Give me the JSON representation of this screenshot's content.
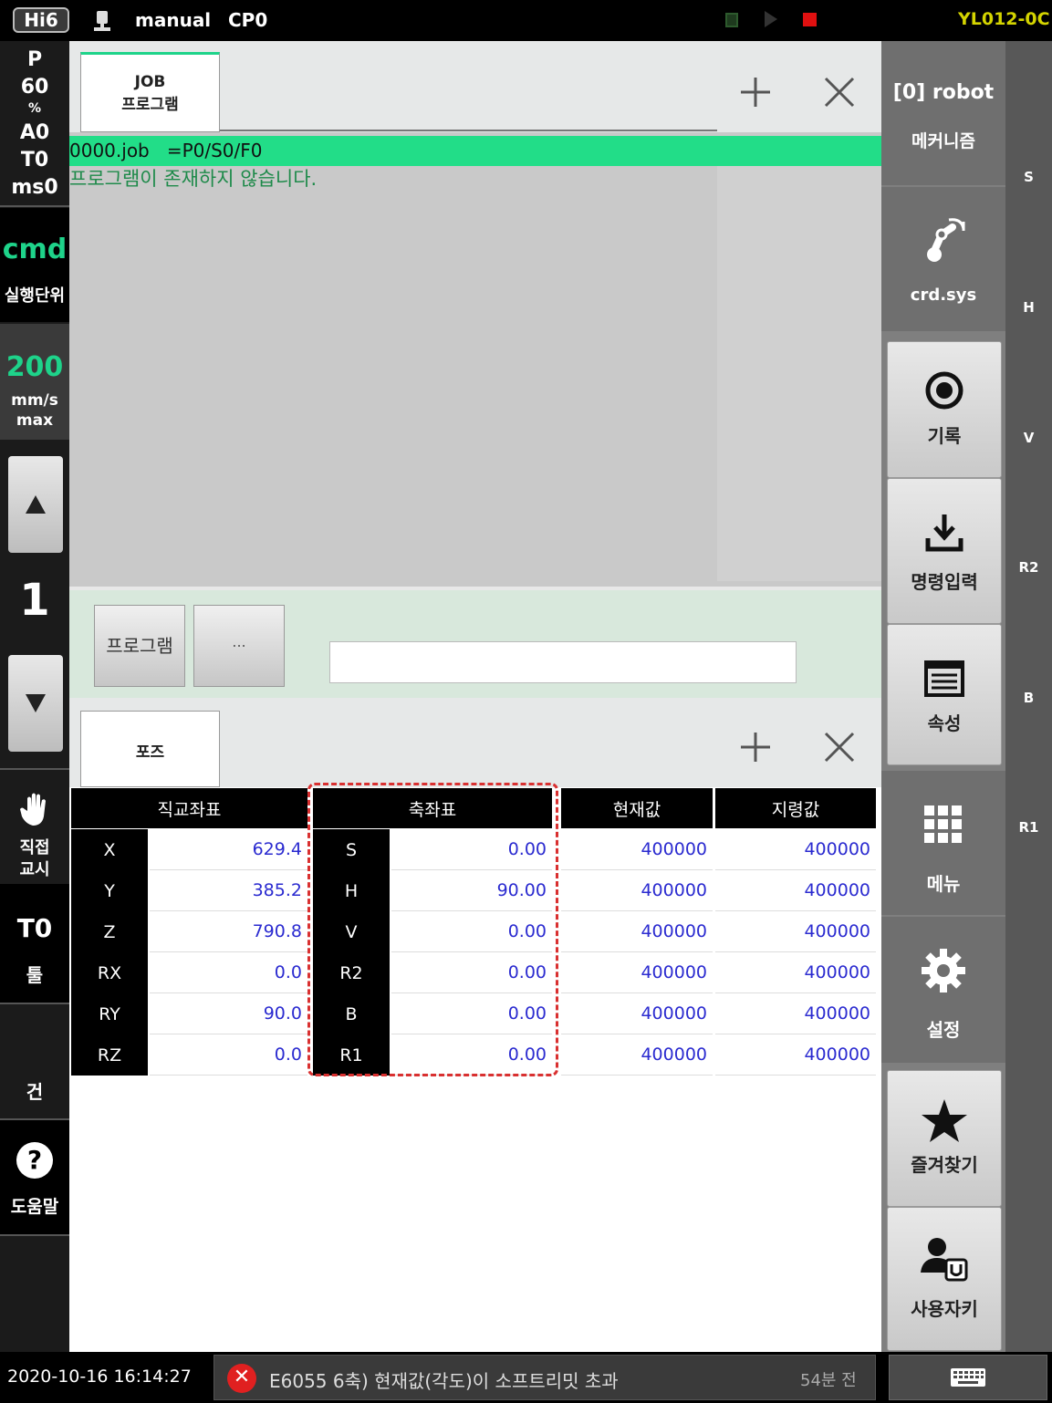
{
  "topbar": {
    "logo": "Hi6",
    "mode": "manual",
    "program_slot": "CP0",
    "controller_id": "YL012-0C"
  },
  "left": {
    "p_label": "P",
    "p_value": "60",
    "percent": "%",
    "a_value": "A0",
    "t_value": "T0",
    "ms_value": "ms0",
    "cmd": "cmd",
    "exec_unit": "실행단위",
    "speed": "200",
    "speed_unit": "mm/s",
    "speed_mode": "max",
    "step": "1",
    "direct_teach": [
      "직접",
      "교시"
    ],
    "tool_value": "T0",
    "tool_label": "툴",
    "gun": "건",
    "help": "도움말"
  },
  "job_panel": {
    "tab_label": [
      "JOB",
      "프로그램"
    ],
    "status_line": "0000.job   =P0/S0/F0",
    "message": "프로그램이 존재하지 않습니다.",
    "program_button": "프로그램",
    "more_button": "...",
    "command_input_value": ""
  },
  "pose_panel": {
    "tab_label": "포즈",
    "headers": {
      "cartesian": "직교좌표",
      "axis": "축좌표",
      "current": "현재값",
      "command": "지령값"
    },
    "rows": [
      {
        "c_label": "X",
        "c_value": "629.4",
        "a_label": "S",
        "a_value": "0.00",
        "current": "400000",
        "command": "400000"
      },
      {
        "c_label": "Y",
        "c_value": "385.2",
        "a_label": "H",
        "a_value": "90.00",
        "current": "400000",
        "command": "400000"
      },
      {
        "c_label": "Z",
        "c_value": "790.8",
        "a_label": "V",
        "a_value": "0.00",
        "current": "400000",
        "command": "400000"
      },
      {
        "c_label": "RX",
        "c_value": "0.0",
        "a_label": "R2",
        "a_value": "0.00",
        "current": "400000",
        "command": "400000"
      },
      {
        "c_label": "RY",
        "c_value": "90.0",
        "a_label": "B",
        "a_value": "0.00",
        "current": "400000",
        "command": "400000"
      },
      {
        "c_label": "RZ",
        "c_value": "0.0",
        "a_label": "R1",
        "a_value": "0.00",
        "current": "400000",
        "command": "400000"
      }
    ]
  },
  "right": {
    "robot": "[0] robot",
    "mechanism": "메커니즘",
    "coord_sys": "crd.sys",
    "record": "기록",
    "command_input": "명령입력",
    "properties": "속성",
    "menu": "메뉴",
    "settings": "설정",
    "favorites": "즐겨찾기",
    "user_keys": "사용자키"
  },
  "axis_labels": [
    "S",
    "H",
    "V",
    "R2",
    "B",
    "R1"
  ],
  "bottombar": {
    "datetime": "2020-10-16 16:14:27",
    "error_message": "E6055 6축) 현재값(각도)이 소프트리밋 초과",
    "error_age": "54분 전"
  },
  "colors": {
    "accent_green": "#1ed38a",
    "highlight_bar": "#22dd88",
    "value_blue": "#2b2bd0",
    "error_red": "#e02020",
    "dashed_highlight": "#d93030"
  }
}
